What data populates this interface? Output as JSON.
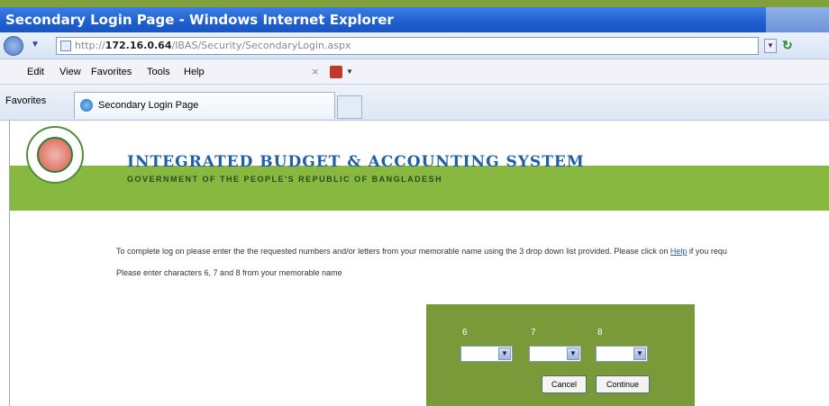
{
  "window": {
    "title": "Secondary Login Page - Windows Internet Explorer"
  },
  "address": {
    "scheme_path": "http://",
    "host": "172.16.0.64",
    "path": "/IBAS/Security/SecondaryLogin.aspx"
  },
  "menu": [
    "Edit",
    "View",
    "Favorites",
    "Tools",
    "Help"
  ],
  "favorites": {
    "label": "Favorites"
  },
  "tab": {
    "label": "Secondary Login Page"
  },
  "org": {
    "title": "INTEGRATED BUDGET & ACCOUNTING SYSTEM",
    "subtitle": "GOVERNMENT OF THE PEOPLE'S REPUBLIC OF BANGLADESH"
  },
  "instructions": {
    "text_before": "To complete log on please enter the the requested numbers and/or letters from your memorable name using the 3 drop down list provided. Please click on ",
    "help_link": "Help",
    "text_after": " if you requ"
  },
  "hint": "Please enter characters 6, 7 and 8 from your memorable name",
  "login": {
    "labels": [
      "6",
      "7",
      "8"
    ],
    "cancel": "Cancel",
    "continue": "Continue"
  },
  "colors": {
    "accent_green": "#7a9a3a",
    "banner_green": "#88b840",
    "title_blue": "#1f5fa8"
  }
}
